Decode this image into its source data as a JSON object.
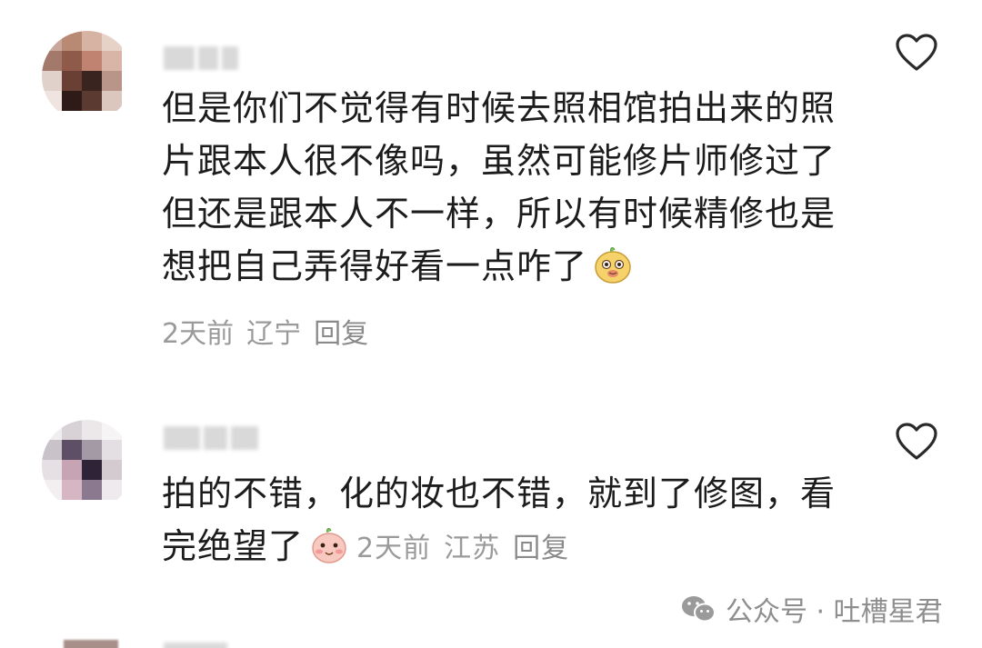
{
  "comments": [
    {
      "text": "但是你们不觉得有时候去照相馆拍出来的照片跟本人很不像吗，虽然可能修片师修过了但还是跟本人不一样，所以有时候精修也是想把自己弄得好看一点咋了",
      "line1": "但是你们不觉得有时候去照相馆拍出来的照",
      "line2": "片跟本人很不像吗，虽然可能修片师修过了",
      "line3": "但还是跟本人不一样，所以有时候精修也是",
      "line4": "想把自己弄得好看一点咋了",
      "emoji": "smirk-face-emoji",
      "time": "2天前",
      "location": "辽宁",
      "reply_label": "回复",
      "like_icon": "heart-outline-icon"
    },
    {
      "line1": "拍的不错，化的妆也不错，就到了修图，看",
      "line2": "完绝望了",
      "emoji": "blush-face-emoji",
      "time": "2天前",
      "location": "江苏",
      "reply_label": "回复",
      "like_icon": "heart-outline-icon"
    }
  ],
  "watermark": {
    "text": "公众号 · 吐槽星君",
    "icon": "wechat-icon"
  }
}
